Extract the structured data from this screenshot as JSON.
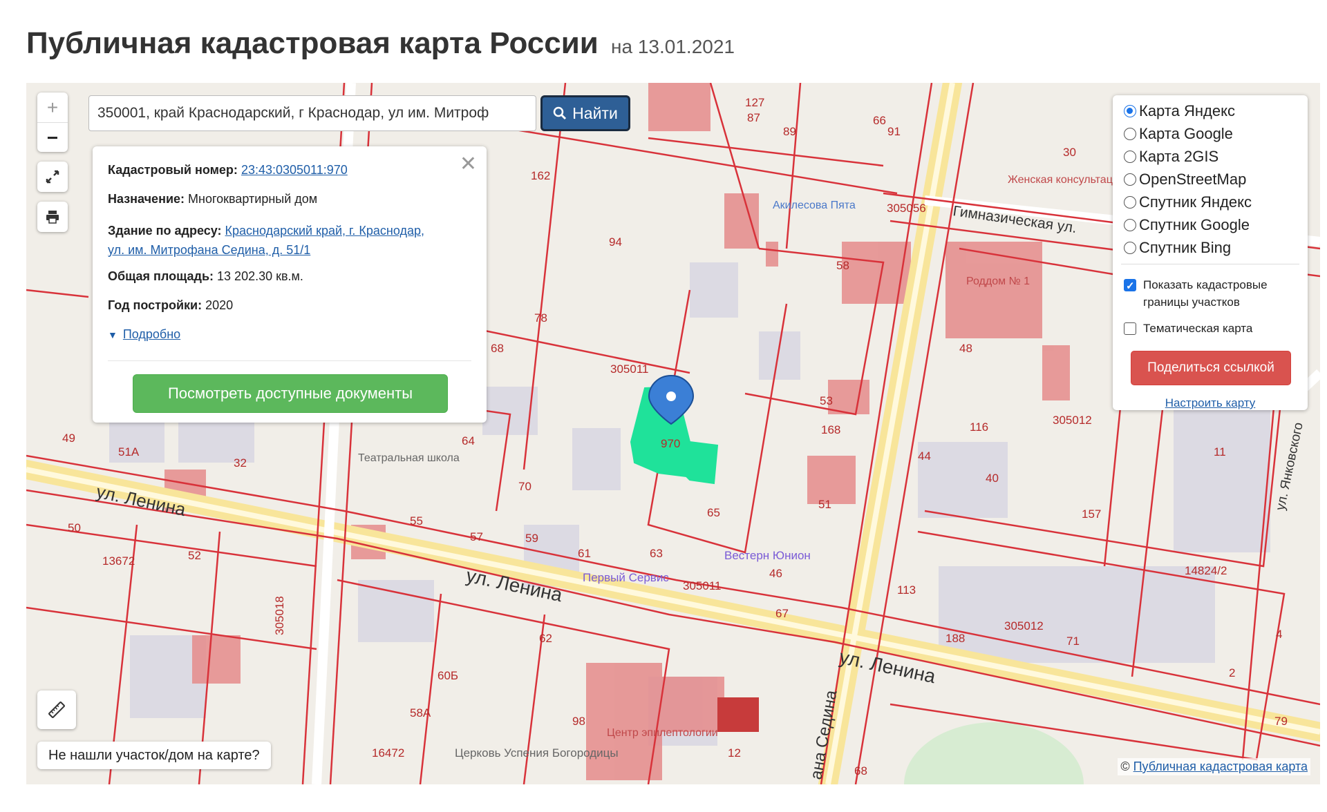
{
  "page": {
    "title": "Публичная кадастровая карта России",
    "date": "на 13.01.2021"
  },
  "search": {
    "value": "350001, край Краснодарский, г Краснодар, ул им. Митроф",
    "button_label": "Найти",
    "icon": "search-icon"
  },
  "map_controls": {
    "zoom_in": "+",
    "zoom_out": "−",
    "fullscreen_icon": "fullscreen-icon",
    "print_icon": "print-icon",
    "ruler_icon": "ruler-icon"
  },
  "info_card": {
    "cadastral_label": "Кадастровый номер:",
    "cadastral_value": "23:43:0305011:970",
    "purpose_label": "Назначение:",
    "purpose_value": "Многоквартирный дом",
    "address_label": "Здание по адресу:",
    "address_line1": "Краснодарский край, г. Краснодар,",
    "address_line2": "ул. им. Митрофана Седина, д. 51/1",
    "area_label": "Общая площадь:",
    "area_value": "13 202.30 кв.м.",
    "year_label": "Год постройки:",
    "year_value": "2020",
    "details_link": "Подробно",
    "docs_button": "Посмотреть доступные документы",
    "close": "✕"
  },
  "layers": {
    "options": [
      {
        "label": "Карта Яндекс",
        "selected": true
      },
      {
        "label": "Карта Google",
        "selected": false
      },
      {
        "label": "Карта 2GIS",
        "selected": false
      },
      {
        "label": "OpenStreetMap",
        "selected": false
      },
      {
        "label": "Спутник Яндекс",
        "selected": false
      },
      {
        "label": "Спутник Google",
        "selected": false
      },
      {
        "label": "Спутник Bing",
        "selected": false
      }
    ],
    "show_boundaries_line1": "Показать кадастровые",
    "show_boundaries_line2": "границы участков",
    "show_boundaries_checked": true,
    "thematic_map": "Тематическая карта",
    "thematic_checked": false,
    "share_button": "Поделиться ссылкой",
    "configure_link": "Настроить карту"
  },
  "footer": {
    "not_found": "Не нашли участок/дом на карте?",
    "copyright_symbol": "©",
    "copyright_link": "Публичная кадастровая карта"
  },
  "map_labels": {
    "quarter_1": "305011",
    "quarter_2": "305011",
    "quarter_3": "305012",
    "quarter_4": "305012",
    "quarter_5": "305056",
    "quarter_6": "305018",
    "street_lenina_1": "ул. Ленина",
    "street_lenina_2": "ул. Ленина",
    "street_lenina_3": "ул. Ленина",
    "street_gymn": "Гимназическая ул.",
    "street_sedina": "ана Седина",
    "street_yankovsk": "ул. Янковского",
    "poi_women": "Женская консультация",
    "poi_rodd": "Роддом № 1",
    "poi_theater": "Театральная школа",
    "poi_western": "Вестерн Юнион",
    "poi_first": "Первый Сервис",
    "poi_church": "Церковь Успения Богородицы",
    "poi_akv": "Акилесова Пята",
    "poi_epi": "Центр эпилептологии",
    "parcel_970": "970",
    "n_94": "94",
    "n_78": "78",
    "n_68": "68",
    "n_64": "64",
    "n_70": "70",
    "n_59": "59",
    "n_61": "61",
    "n_63": "63",
    "n_57": "57",
    "n_55": "55",
    "n_62": "62",
    "n_53": "53",
    "n_51": "51",
    "n_48": "48",
    "n_116": "116",
    "n_44": "44",
    "n_40": "40",
    "n_113": "113",
    "n_188": "188",
    "n_71": "71",
    "n_11": "11",
    "n_79": "79",
    "n_13672": "13672",
    "n_49": "49",
    "n_51a": "51А",
    "n_32": "32",
    "n_162": "162",
    "n_127": "127",
    "n_87": "87",
    "n_91": "91",
    "n_66": "66",
    "n_30": "30",
    "n_58": "58",
    "n_168": "168",
    "n_67": "67",
    "n_46": "46",
    "n_65": "65",
    "n_60b": "60Б",
    "n_58a": "58А",
    "n_16472": "16472",
    "n_12": "12",
    "n_68b": "68",
    "n_98": "98",
    "n_157": "157",
    "n_14824_2": "14824/2",
    "n_89": "89",
    "n_52": "52",
    "n_50": "50",
    "n_2": "2",
    "n_4": "4"
  }
}
